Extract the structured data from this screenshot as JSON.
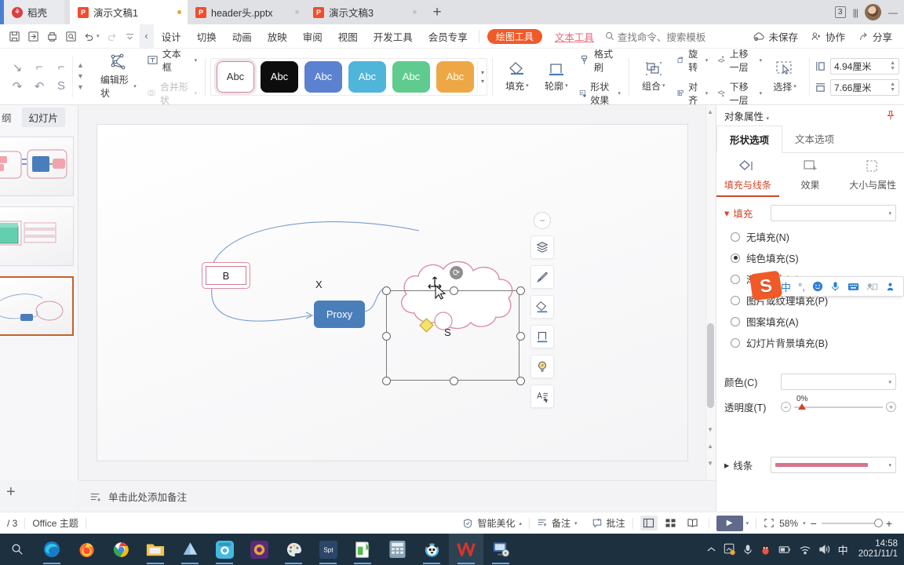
{
  "window": {
    "tabs": [
      {
        "label": "稻壳",
        "icon": "rice-husk-icon",
        "state": "home"
      },
      {
        "label": "演示文稿1",
        "icon": "wps-presentation-icon",
        "state": "active"
      },
      {
        "label": "header头.pptx",
        "icon": "wps-presentation-icon",
        "state": "inactive"
      },
      {
        "label": "演示文稿3",
        "icon": "wps-presentation-icon",
        "state": "inactive"
      }
    ],
    "new_tab_label": "+",
    "tab_count": "3",
    "minimize": "—"
  },
  "menu": {
    "quick_icons": [
      "save-icon",
      "save-as-icon",
      "print-icon",
      "print-preview-icon",
      "undo-icon",
      "redo-icon",
      "more-icon"
    ],
    "collapse_label": "‹",
    "items": [
      "设计",
      "切换",
      "动画",
      "放映",
      "审阅",
      "视图",
      "开发工具",
      "会员专享"
    ],
    "drawing_tools_pill": "绘图工具",
    "text_tools": "文本工具",
    "search_placeholder": "查找命令、搜索模板",
    "right_items": [
      {
        "label": "未保存",
        "icon": "cloud-unsaved-icon"
      },
      {
        "label": "协作",
        "icon": "collaborate-icon"
      },
      {
        "label": "分享",
        "icon": "share-icon"
      }
    ]
  },
  "ribbon": {
    "shape_gallery_name": "shape-gallery",
    "edit_shape": "编辑形状",
    "text_box": "文本框",
    "merge_shape": "合并形状",
    "styles": [
      {
        "label": "Abc",
        "bg": "#ffffff",
        "fg": "#333333",
        "selected": true
      },
      {
        "label": "Abc",
        "bg": "#0d0d0d",
        "fg": "#ffffff",
        "selected": false
      },
      {
        "label": "Abc",
        "bg": "#5b82d0",
        "fg": "#ffffff",
        "selected": false
      },
      {
        "label": "Abc",
        "bg": "#4fb5d9",
        "fg": "#ffffff",
        "selected": false
      },
      {
        "label": "Abc",
        "bg": "#5fcb8e",
        "fg": "#ffffff",
        "selected": false
      },
      {
        "label": "Abc",
        "bg": "#eda845",
        "fg": "#ffffff",
        "selected": false
      }
    ],
    "fill": "填充",
    "outline": "轮廓",
    "format_painter": "格式刷",
    "shape_effect": "形状效果",
    "group": "组合",
    "rotate": "旋转",
    "align": "对齐",
    "bring_forward": "上移一层",
    "send_backward": "下移一层",
    "select": "选择",
    "height_value": "4.94厘米",
    "width_value": "7.66厘米"
  },
  "left_panel": {
    "tab_outline": "纲",
    "tab_slides": "幻灯片",
    "add_slide": "+",
    "thumbnails": [
      {
        "index": "1",
        "selected": false
      },
      {
        "index": "2",
        "selected": false
      },
      {
        "index": "3",
        "selected": true
      }
    ]
  },
  "canvas": {
    "shapes": [
      {
        "name": "rect-b",
        "label": "B",
        "type": "rectangle",
        "stroke": "#cf7a8e"
      },
      {
        "name": "proxy-box",
        "label": "Proxy",
        "type": "rounded-rect",
        "fill": "#4a7ebb",
        "fg": "#ffffff"
      },
      {
        "name": "cloud-shape",
        "label": "S",
        "type": "cloud",
        "stroke": "#d98fa3",
        "selected": true
      },
      {
        "name": "curve-label-x",
        "label": "X",
        "type": "label"
      }
    ],
    "selection": {
      "handles": 8,
      "rotate_handle": "rotate-handle",
      "adjust_handle": "yellow-diamond-handle"
    }
  },
  "float_toolbar": {
    "items": [
      {
        "name": "collapse-panel-button",
        "icon": "minus-icon"
      },
      {
        "name": "layers-button",
        "icon": "layers-icon"
      },
      {
        "name": "brush-button",
        "icon": "brush-icon"
      },
      {
        "name": "fill-button",
        "icon": "fill-icon"
      },
      {
        "name": "outline-button",
        "icon": "outline-icon"
      },
      {
        "name": "smart-idea-button",
        "icon": "lightbulb-icon"
      },
      {
        "name": "text-format-button",
        "icon": "text-format-icon"
      }
    ]
  },
  "notes": {
    "placeholder": "单击此处添加备注",
    "icon": "notes-icon"
  },
  "right_panel": {
    "title": "对象属性",
    "pin_icon": "pin-icon",
    "tabs": [
      {
        "label": "形状选项",
        "active": true
      },
      {
        "label": "文本选项",
        "active": false
      }
    ],
    "icon_tabs": [
      {
        "label": "填充与线条",
        "active": true,
        "icon": "fill-line-icon"
      },
      {
        "label": "效果",
        "active": false,
        "icon": "effects-icon"
      },
      {
        "label": "大小与属性",
        "active": false,
        "icon": "size-props-icon"
      }
    ],
    "fill_section": "填充",
    "fill_options": [
      {
        "label": "无填充(N)",
        "key": "N",
        "selected": false
      },
      {
        "label": "纯色填充(S)",
        "key": "S",
        "selected": true
      },
      {
        "label": "渐变填充(G)",
        "key": "G",
        "selected": false
      },
      {
        "label": "图片或纹理填充(P)",
        "key": "P",
        "selected": false
      },
      {
        "label": "图案填充(A)",
        "key": "A",
        "selected": false
      },
      {
        "label": "幻灯片背景填充(B)",
        "key": "B",
        "selected": false
      }
    ],
    "color_label": "颜色(C)",
    "transparency_label": "透明度(T)",
    "transparency_value": "0%",
    "line_section": "线条",
    "line_color": "#d4748c"
  },
  "ime": {
    "logo": "S",
    "items": [
      "中",
      "°,",
      "emoji-icon",
      "mic-icon",
      "keyboard-icon",
      "user-icon",
      "tools-icon"
    ]
  },
  "status_bar": {
    "slide_counter": "/ 3",
    "theme": "Office 主题",
    "beautify": "智能美化",
    "notes": "备注",
    "comments": "批注",
    "views": [
      "normal-view",
      "slide-sorter-view",
      "reading-view"
    ],
    "play": "▶",
    "zoom": "58%",
    "zoom_out": "−",
    "zoom_in": "+"
  },
  "taskbar": {
    "start_icon": "search-icon",
    "apps": [
      {
        "name": "edge-icon",
        "glyph": "e",
        "color": "#2e8ad6",
        "open": true
      },
      {
        "name": "firefox-icon",
        "glyph": "🦊",
        "color": "#e8702a",
        "open": false
      },
      {
        "name": "chrome-icon",
        "glyph": "◉",
        "color": "#4285f4",
        "open": false
      },
      {
        "name": "file-explorer-icon",
        "glyph": "📁",
        "color": "#f3c34f",
        "open": true
      },
      {
        "name": "notes-app-icon",
        "glyph": "📘",
        "color": "#8ec6e8",
        "open": true
      },
      {
        "name": "live-app-icon",
        "glyph": "🐬",
        "color": "#45b8e0",
        "open": true
      },
      {
        "name": "game-app-icon",
        "glyph": "🎛",
        "color": "#8a4ab0",
        "open": false
      },
      {
        "name": "paint-app-icon",
        "glyph": "🎨",
        "color": "#d8d8d8",
        "open": true
      },
      {
        "name": "spt-app-icon",
        "glyph": "Spt",
        "color": "#2f4a6e",
        "open": true
      },
      {
        "name": "editor-app-icon",
        "glyph": "📗",
        "color": "#58b94a",
        "open": true
      },
      {
        "name": "calculator-icon",
        "glyph": "🖩",
        "color": "#7a99ad",
        "open": false
      },
      {
        "name": "panda-app-icon",
        "glyph": "🐼",
        "color": "#5bb8e8",
        "open": true
      },
      {
        "name": "wps-app-icon",
        "glyph": "W",
        "color": "#d8342a",
        "open": true
      },
      {
        "name": "remote-desktop-icon",
        "glyph": "🖥",
        "color": "#4a7ebb",
        "open": true
      }
    ],
    "tray": [
      "show-hidden-icons",
      "screenshot-icon",
      "mic-icon",
      "qq-icon",
      "battery-icon",
      "wifi-icon",
      "volume-icon",
      "ime-indicator"
    ],
    "ime_indicator": "中",
    "time": "14:58",
    "date": "2021/11/1"
  }
}
